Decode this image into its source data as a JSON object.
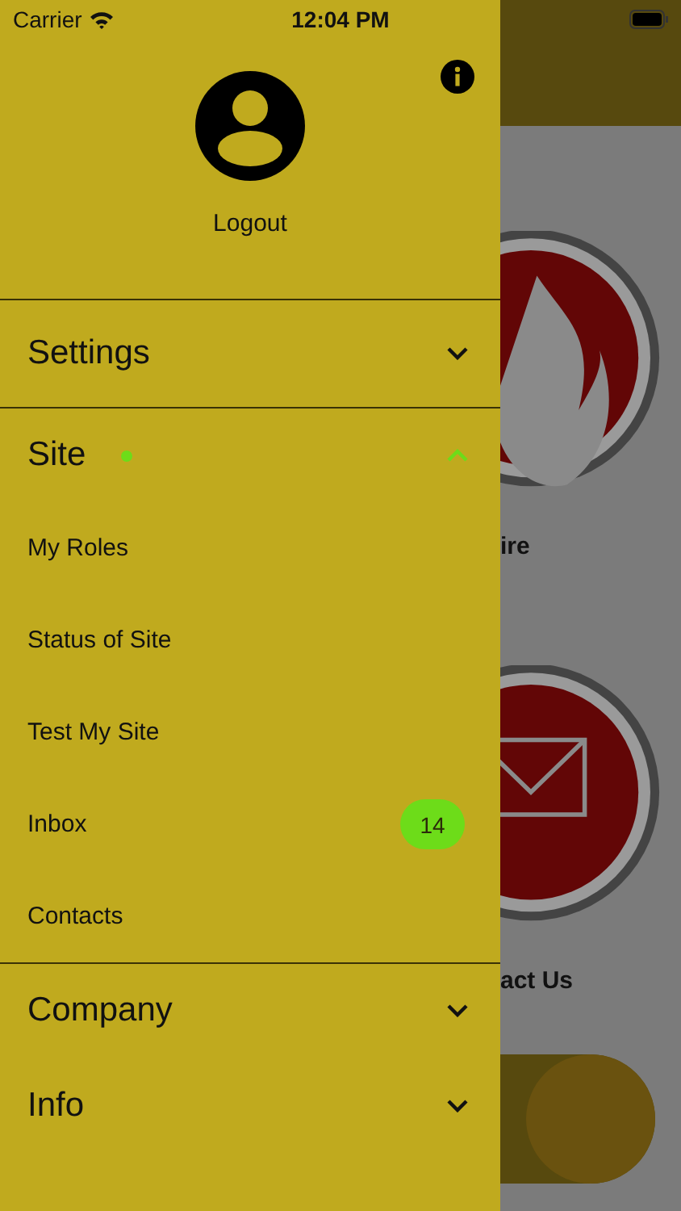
{
  "status_bar": {
    "carrier": "Carrier",
    "time": "12:04 PM"
  },
  "drawer": {
    "account": {
      "label": "Logout"
    },
    "sections": [
      {
        "title": "Settings",
        "expanded": false,
        "notify": false
      },
      {
        "title": "Site",
        "expanded": true,
        "notify": true,
        "children": [
          {
            "label": "My Roles"
          },
          {
            "label": "Status of Site"
          },
          {
            "label": "Test My Site"
          },
          {
            "label": "Inbox",
            "badge": "14"
          },
          {
            "label": "Contacts"
          }
        ]
      },
      {
        "title": "Company",
        "expanded": false,
        "notify": false
      },
      {
        "title": "Info",
        "expanded": false,
        "notify": false
      }
    ]
  },
  "background": {
    "tiles": [
      {
        "kind": "fire",
        "label": "ire"
      },
      {
        "kind": "mail",
        "label": "act Us"
      }
    ]
  }
}
